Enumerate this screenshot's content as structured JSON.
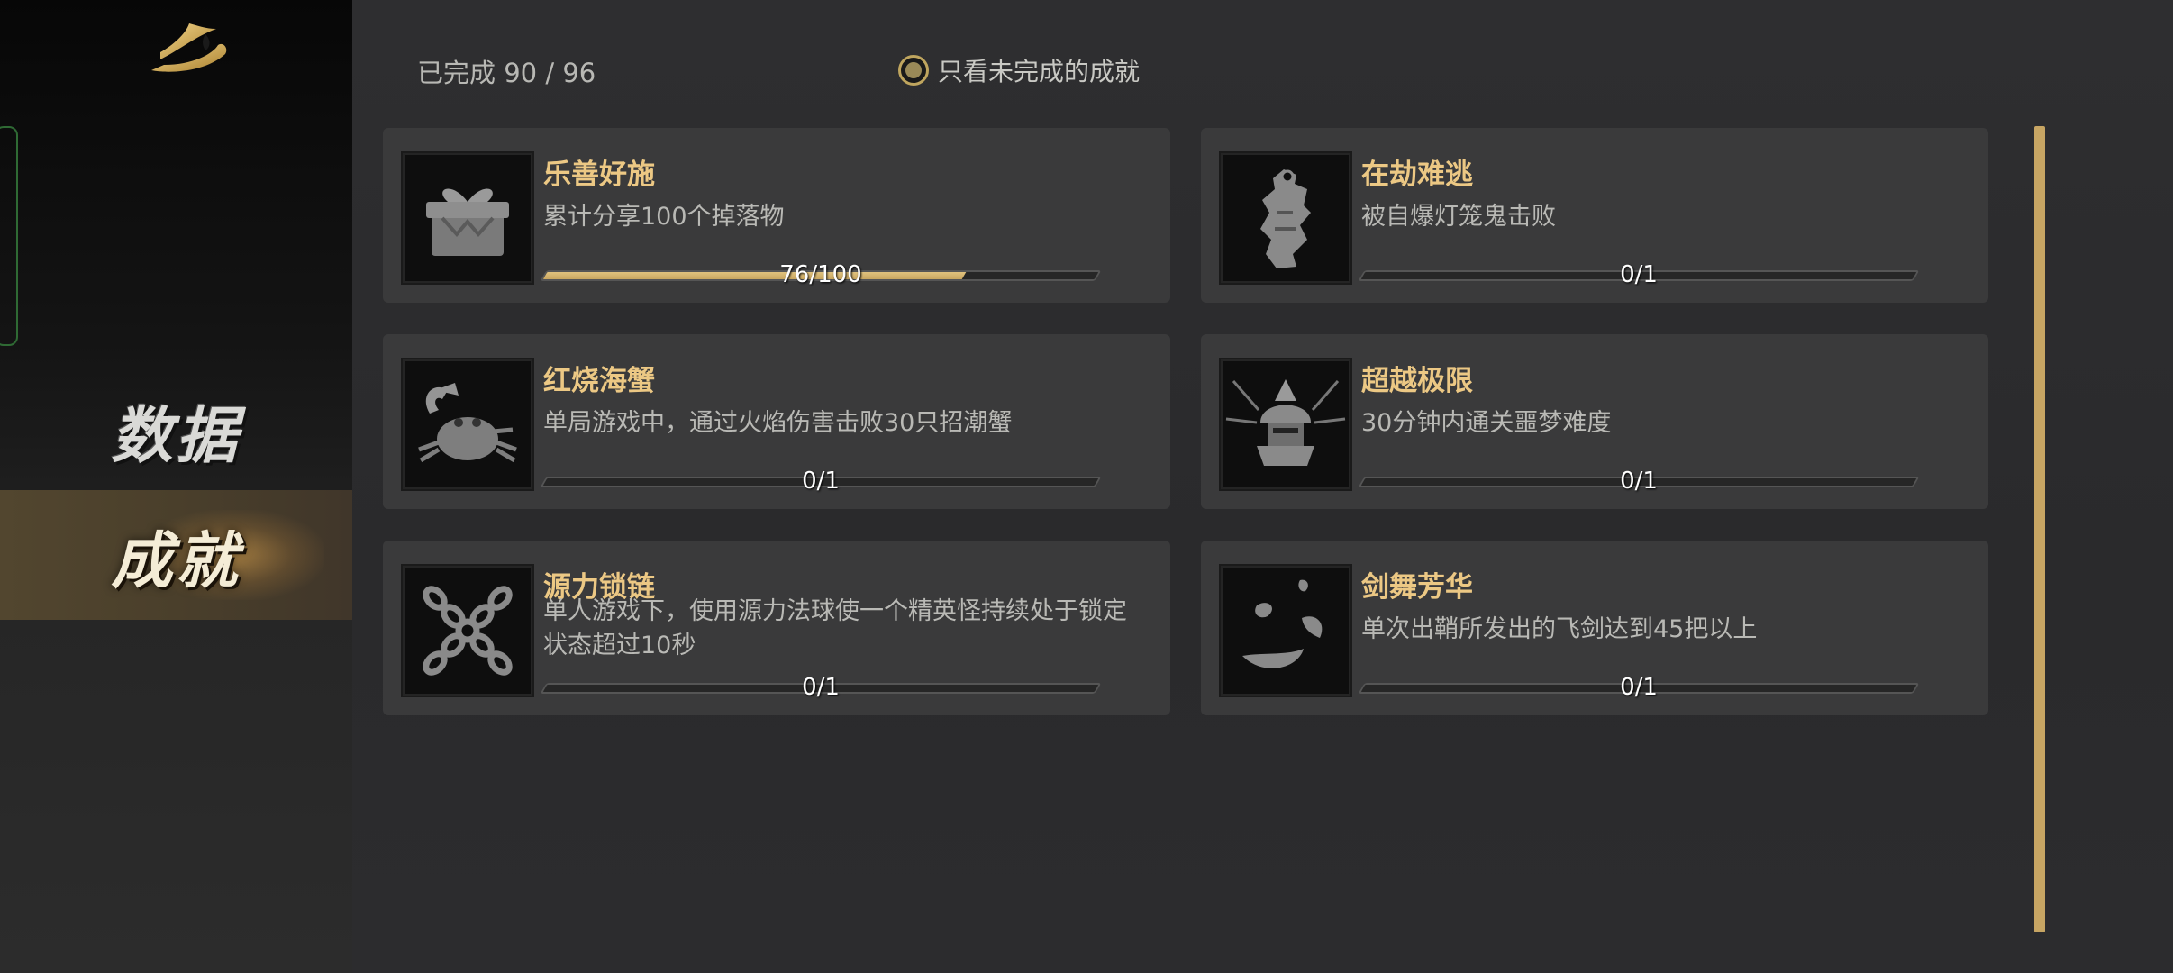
{
  "sidebar": {
    "items": [
      {
        "label": "数据",
        "selected": false
      },
      {
        "label": "成就",
        "selected": true
      }
    ]
  },
  "header": {
    "progress": "已完成 90 / 96",
    "filter_label": "只看未完成的成就",
    "filter_checked": true
  },
  "achievements": [
    {
      "title": "乐善好施",
      "desc": "累计分享100个掉落物",
      "progress_text": "76/100",
      "progress": 0.76,
      "icon": "gift-box-icon"
    },
    {
      "title": "在劫难逃",
      "desc": "被自爆灯笼鬼击败",
      "progress_text": "0/1",
      "progress": 0,
      "icon": "lantern-ghost-icon"
    },
    {
      "title": "红烧海蟹",
      "desc": "单局游戏中，通过火焰伤害击败30只招潮蟹",
      "progress_text": "0/1",
      "progress": 0,
      "icon": "crab-icon"
    },
    {
      "title": "超越极限",
      "desc": "30分钟内通关噩梦难度",
      "progress_text": "0/1",
      "progress": 0,
      "icon": "samurai-helmet-icon"
    },
    {
      "title": "源力锁链",
      "desc": "单人游戏下，使用源力法球使一个精英怪持续处于锁定状态超过10秒",
      "progress_text": "0/1",
      "progress": 0,
      "icon": "crossed-chains-icon"
    },
    {
      "title": "剑舞芳华",
      "desc": "单次出鞘所发出的飞剑达到45把以上",
      "progress_text": "0/1",
      "progress": 0,
      "icon": "petals-icon"
    }
  ],
  "colors": {
    "accent_gold": "#c7a563",
    "title_gold": "#ecc884",
    "card_bg": "#3a3a3b"
  }
}
